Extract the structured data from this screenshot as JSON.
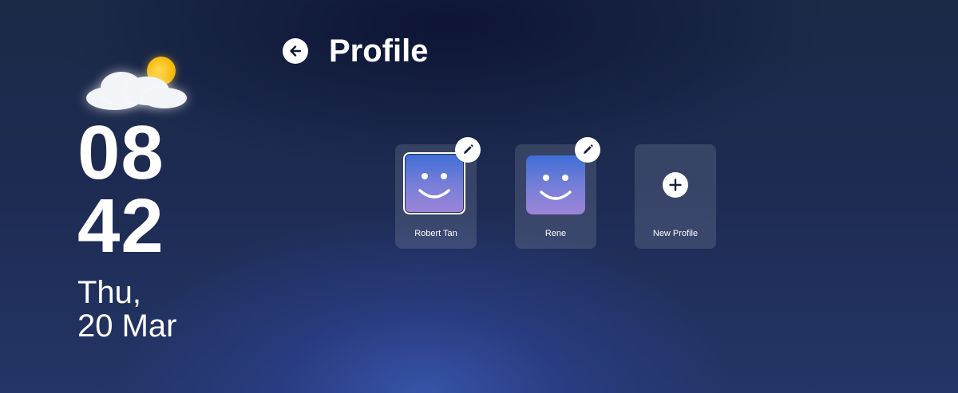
{
  "weather": {
    "icon": "partly-cloudy-icon"
  },
  "clock": {
    "hours": "08",
    "minutes": "42"
  },
  "date": {
    "weekday": "Thu,",
    "day_month": "20 Mar"
  },
  "header": {
    "title": "Profile",
    "back_icon": "arrow-left-icon"
  },
  "profiles": [
    {
      "name": "Robert Tan",
      "selected": true,
      "icon": "smiley-face-icon"
    },
    {
      "name": "Rene",
      "selected": false,
      "icon": "smiley-face-icon"
    }
  ],
  "new_profile": {
    "label": "New Profile",
    "icon": "plus-icon"
  },
  "colors": {
    "accent_top": "#3f6fd6",
    "accent_bottom": "#9c84d8",
    "background": "#1d2b52"
  }
}
